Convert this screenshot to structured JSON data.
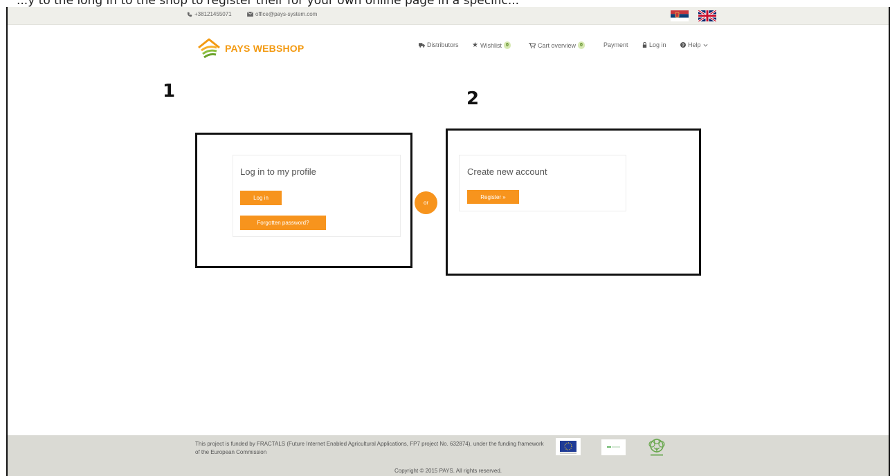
{
  "caption": "...y to the long in to the shop to register their for your own online page in a specific...",
  "topbar": {
    "phone": "+38121455071",
    "email": "office@pays-system.com"
  },
  "languages": [
    "Serbian",
    "English"
  ],
  "logo": {
    "text": "PAYS WEBSHOP"
  },
  "nav": {
    "distributors": "Distributors",
    "wishlist": "Wishlist",
    "wishlist_count": "0",
    "cart": "Cart overview",
    "cart_count": "0",
    "payment": "Payment",
    "login": "Log in",
    "help": "Help"
  },
  "annotations": {
    "step1": "1",
    "step2": "2"
  },
  "login_panel": {
    "title": "Log in to my profile",
    "login_button": "Log in",
    "forgot_button": "Forgotten password?"
  },
  "separator": "or",
  "register_panel": {
    "title": "Create new account",
    "register_button": "Register »"
  },
  "footer": {
    "funding_text": "This project is funded by FRACTALS (Future Internet Enabled Agricultural Applications, FP7 project No. 632874), under the funding framework of the European Commission",
    "copyright": "Copyright © 2015 PAYS. All rights reserved."
  },
  "colors": {
    "accent": "#f7941d",
    "logo_green": "#7cb342",
    "topbar_bg": "#efefea",
    "footer_bg": "#dadad4"
  }
}
